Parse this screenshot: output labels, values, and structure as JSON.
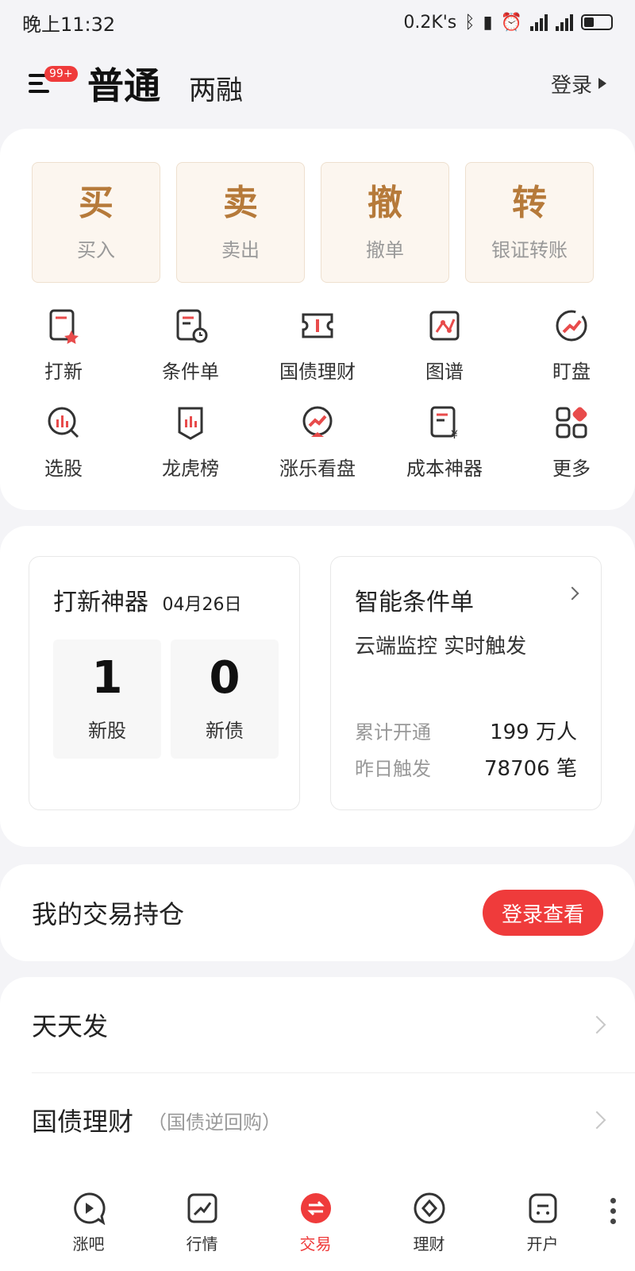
{
  "status_bar": {
    "time": "晚上11:32",
    "net_speed": "0.2K's",
    "sig1": "3G",
    "sig2": "4G",
    "battery": "40"
  },
  "header": {
    "badge": "99+",
    "tab_normal": "普通",
    "tab_margin": "两融",
    "login": "登录"
  },
  "trade_buttons": [
    {
      "glyph": "买",
      "label": "买入"
    },
    {
      "glyph": "卖",
      "label": "卖出"
    },
    {
      "glyph": "撤",
      "label": "撤单"
    },
    {
      "glyph": "转",
      "label": "银证转账"
    }
  ],
  "tools": [
    {
      "label": "打新",
      "icon": "new-stock-icon"
    },
    {
      "label": "条件单",
      "icon": "condition-order-icon"
    },
    {
      "label": "国债理财",
      "icon": "treasury-ticket-icon"
    },
    {
      "label": "图谱",
      "icon": "graph-icon"
    },
    {
      "label": "盯盘",
      "icon": "watch-icon"
    },
    {
      "label": "选股",
      "icon": "stock-picker-icon"
    },
    {
      "label": "龙虎榜",
      "icon": "dragon-tiger-icon"
    },
    {
      "label": "涨乐看盘",
      "icon": "market-view-icon"
    },
    {
      "label": "成本神器",
      "icon": "cost-tool-icon"
    },
    {
      "label": "更多",
      "icon": "more-grid-icon"
    }
  ],
  "ipo_card": {
    "title": "打新神器",
    "date": "04月26日",
    "new_stock_count": "1",
    "new_stock_label": "新股",
    "new_bond_count": "0",
    "new_bond_label": "新债"
  },
  "smart_order_card": {
    "title": "智能条件单",
    "desc": "云端监控 实时触发",
    "stat1_label": "累计开通",
    "stat1_value": "199 万人",
    "stat2_label": "昨日触发",
    "stat2_value": "78706 笔"
  },
  "holdings": {
    "title": "我的交易持仓",
    "button": "登录查看"
  },
  "list": [
    {
      "title": "天天发",
      "sub": ""
    },
    {
      "title": "国债理财",
      "sub": "（国债逆回购）"
    }
  ],
  "bottom_nav": [
    {
      "label": "涨吧",
      "icon": "play-bubble-icon"
    },
    {
      "label": "行情",
      "icon": "chart-trend-icon"
    },
    {
      "label": "交易",
      "icon": "exchange-icon"
    },
    {
      "label": "理财",
      "icon": "diamond-coin-icon"
    },
    {
      "label": "开户",
      "icon": "account-open-icon"
    }
  ],
  "colors": {
    "accent": "#ef3b3b",
    "gold": "#b67a3a",
    "background": "#f4f4f7"
  }
}
